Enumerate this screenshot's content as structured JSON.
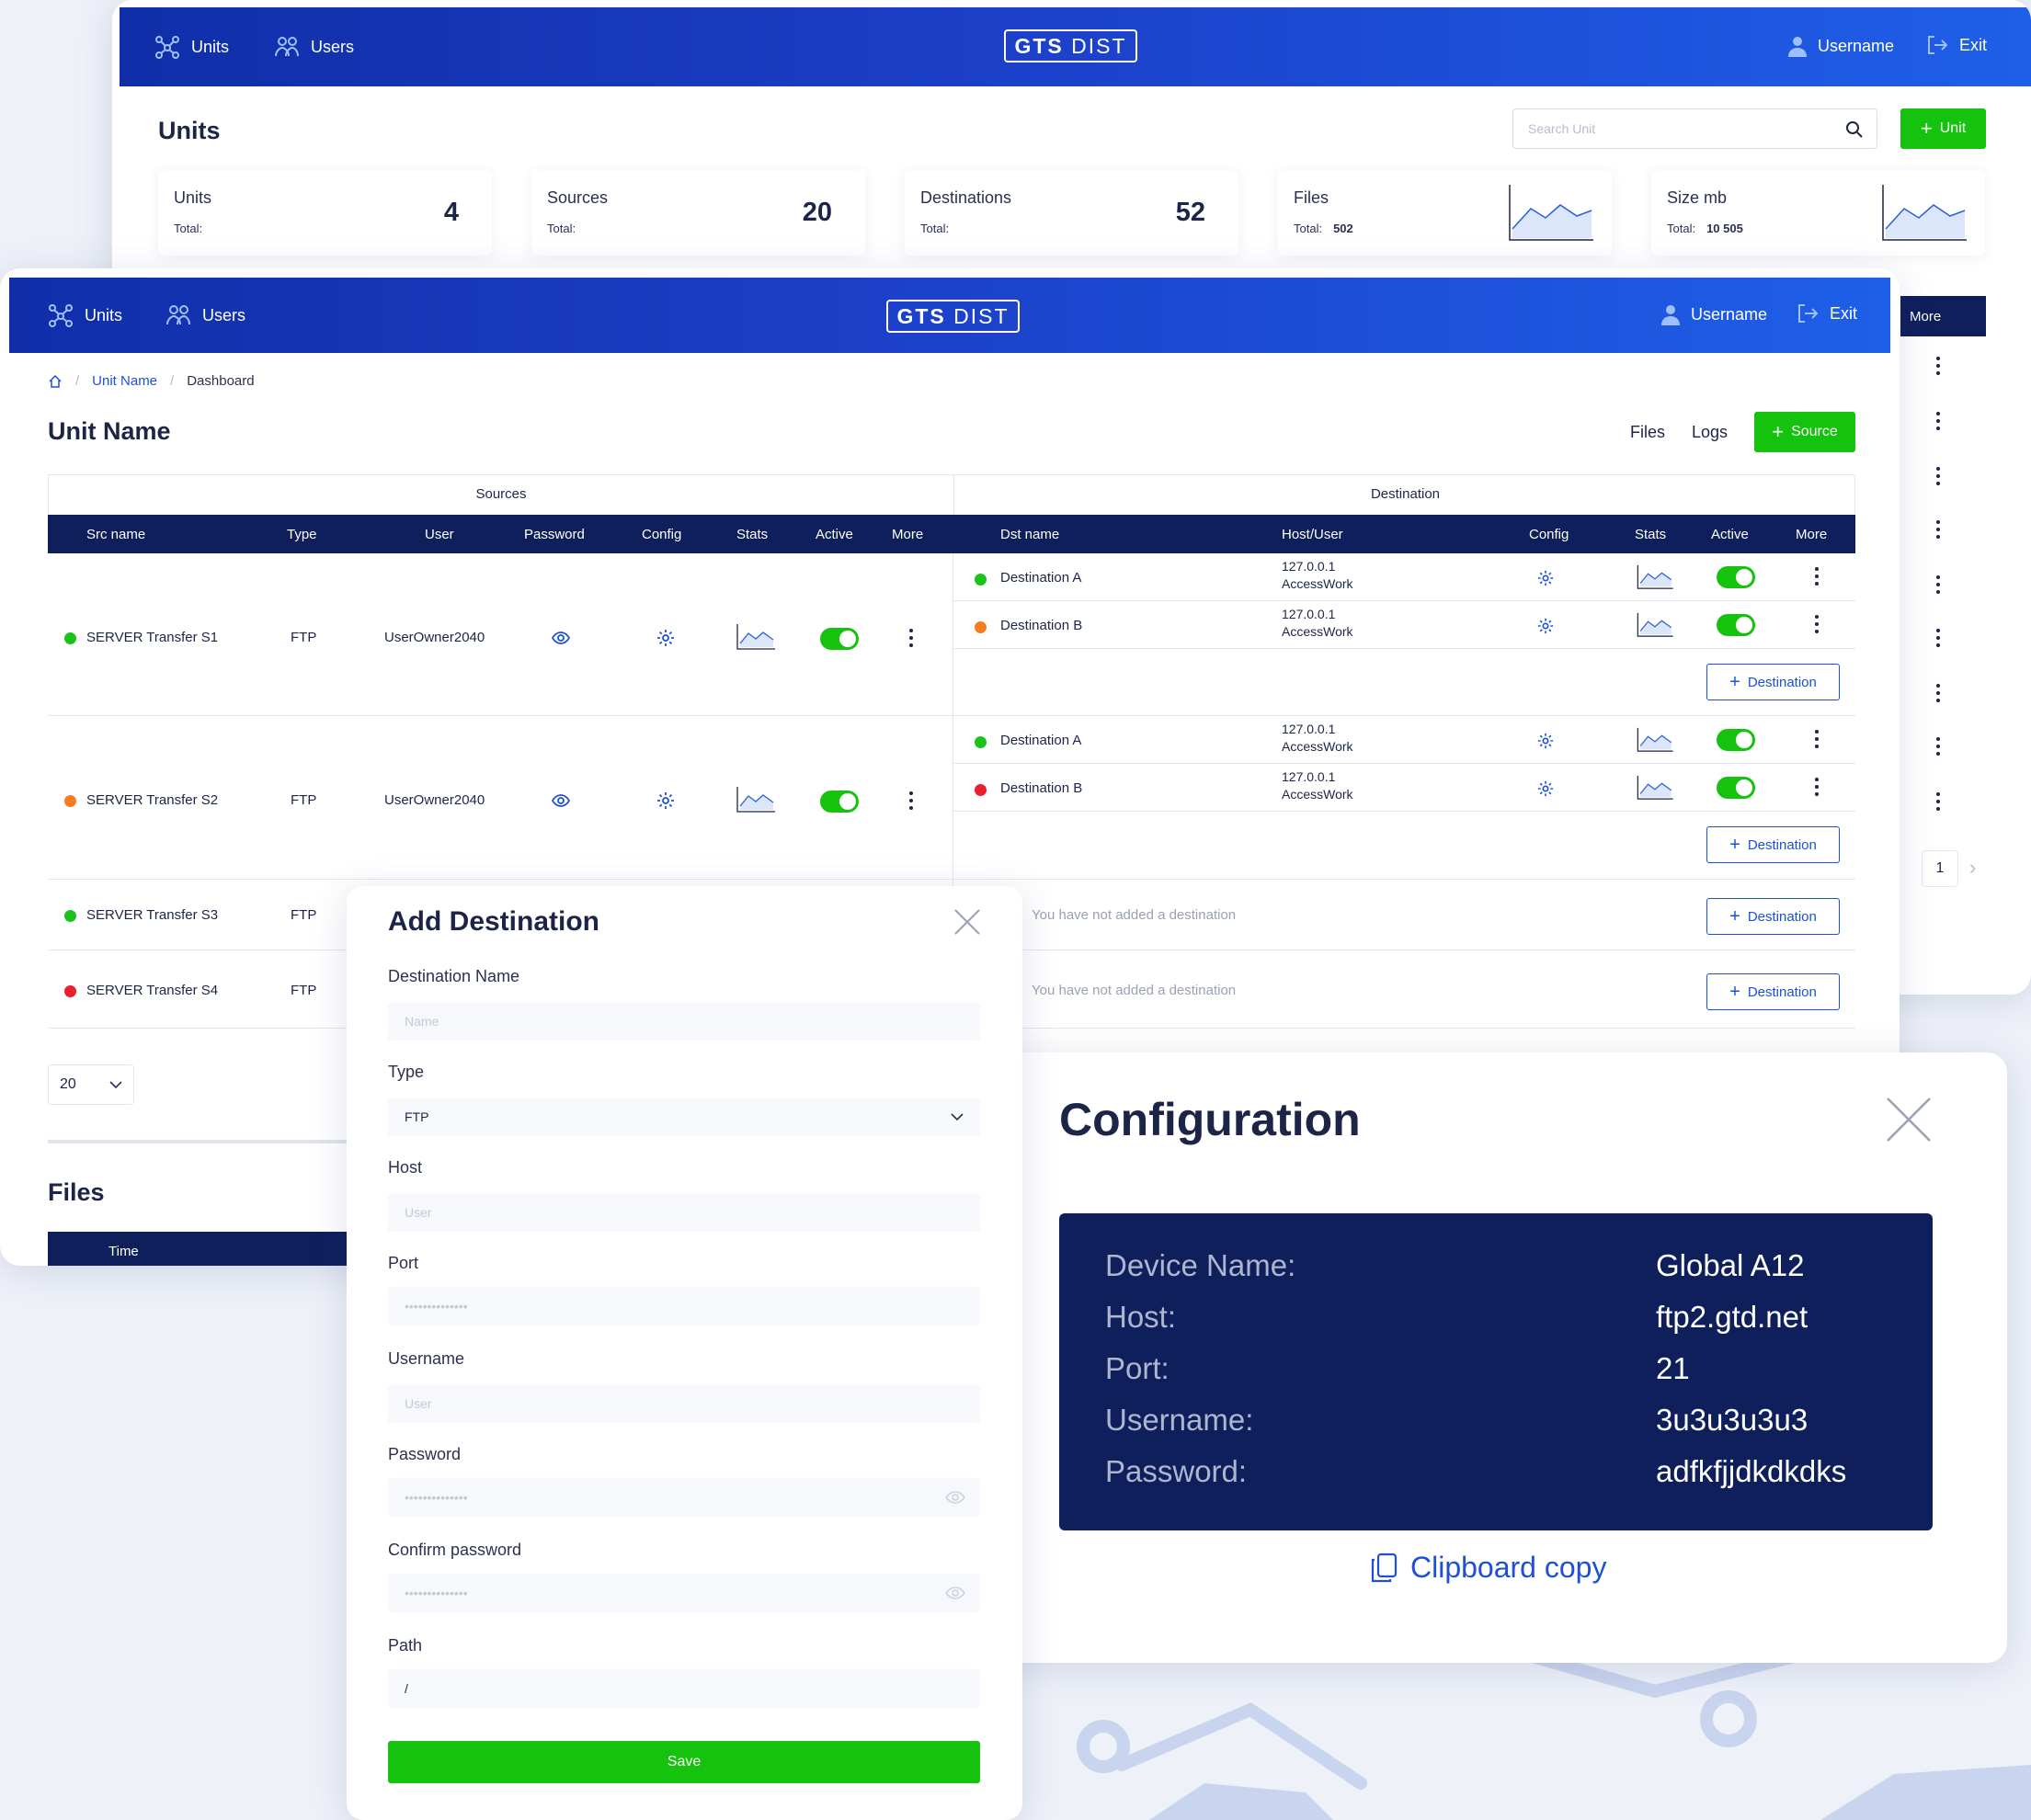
{
  "app": {
    "logo_bold": "GTS",
    "logo_light": "DIST"
  },
  "nav": {
    "units": "Units",
    "users": "Users",
    "username": "Username",
    "exit": "Exit"
  },
  "units_page": {
    "title": "Units",
    "search_placeholder": "Search Unit",
    "add_unit_label": "Unit",
    "stats": [
      {
        "label": "Units",
        "total_label": "Total:",
        "value": "4"
      },
      {
        "label": "Sources",
        "total_label": "Total:",
        "value": "20"
      },
      {
        "label": "Destinations",
        "total_label": "Total:",
        "value": "52"
      },
      {
        "label": "Files",
        "total_label": "Total:",
        "total_value": "502"
      },
      {
        "label": "Size mb",
        "total_label": "Total:",
        "total_value": "10 505"
      }
    ],
    "more_header": "More",
    "pagination_page": "1"
  },
  "unit_detail": {
    "breadcrumb": {
      "unit": "Unit Name",
      "current": "Dashboard"
    },
    "title": "Unit Name",
    "files_link": "Files",
    "logs_link": "Logs",
    "add_source_label": "Source",
    "sources_group": "Sources",
    "destination_group": "Destination",
    "src_columns": [
      "Src name",
      "Type",
      "User",
      "Password",
      "Config",
      "Stats",
      "Active",
      "More"
    ],
    "dst_columns": [
      "Dst name",
      "Host/User",
      "Config",
      "Stats",
      "Active",
      "More"
    ],
    "sources": [
      {
        "name": "SERVER Transfer S1",
        "status": "green",
        "type": "FTP",
        "user": "UserOwner2040",
        "destinations": [
          {
            "name": "Destination A",
            "status": "green",
            "host": "127.0.0.1",
            "user": "AccessWork"
          },
          {
            "name": "Destination B",
            "status": "orange",
            "host": "127.0.0.1",
            "user": "AccessWork"
          }
        ]
      },
      {
        "name": "SERVER Transfer S2",
        "status": "orange",
        "type": "FTP",
        "user": "UserOwner2040",
        "destinations": [
          {
            "name": "Destination A",
            "status": "green",
            "host": "127.0.0.1",
            "user": "AccessWork"
          },
          {
            "name": "Destination B",
            "status": "red",
            "host": "127.0.0.1",
            "user": "AccessWork"
          }
        ]
      },
      {
        "name": "SERVER Transfer S3",
        "status": "green",
        "type": "FTP",
        "empty_text": "You have not added a destination"
      },
      {
        "name": "SERVER Transfer S4",
        "status": "red",
        "type": "FTP",
        "empty_text": "You have not added a destination"
      }
    ],
    "add_destination_label": "Destination",
    "page_size": "20",
    "files_title": "Files",
    "files_col_time": "Time"
  },
  "add_destination": {
    "title": "Add Destination",
    "fields": {
      "name_label": "Destination Name",
      "name_placeholder": "Name",
      "type_label": "Type",
      "type_value": "FTP",
      "host_label": "Host",
      "host_placeholder": "User",
      "port_label": "Port",
      "port_placeholder": "••••••••••••••",
      "username_label": "Username",
      "username_placeholder": "User",
      "password_label": "Password",
      "password_placeholder": "••••••••••••••",
      "confirm_label": "Confirm password",
      "confirm_placeholder": "••••••••••••••",
      "path_label": "Path",
      "path_value": "/"
    },
    "save_label": "Save"
  },
  "configuration": {
    "title": "Configuration",
    "rows": [
      {
        "key": "Device Name:",
        "value": "Global A12"
      },
      {
        "key": "Host:",
        "value": "ftp2.gtd.net"
      },
      {
        "key": "Port:",
        "value": "21"
      },
      {
        "key": "Username:",
        "value": "3u3u3u3u3"
      },
      {
        "key": "Password:",
        "value": "adfkfjjdkdkdks"
      }
    ],
    "copy_label": "Clipboard copy"
  },
  "colors": {
    "primary": "#1e4fd8",
    "navy": "#0f1f5c",
    "green": "#15c20e",
    "orange": "#f57c1f",
    "red": "#e8202e"
  }
}
